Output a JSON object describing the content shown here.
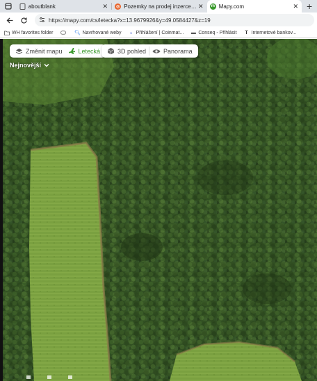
{
  "tabs": [
    {
      "title": "aboutblank",
      "active": false
    },
    {
      "title": "Pozemky na prodej inzerce - Real",
      "active": false
    },
    {
      "title": "Mapy.com",
      "active": true
    }
  ],
  "address": {
    "url": "https://mapy.com/cs/letecka?x=13.9679926&y=49.0584427&z=19"
  },
  "bookmarks": [
    {
      "label": "WH favorites folder",
      "icon": "folder-icon"
    },
    {
      "label": "",
      "icon": "bookmark-device-icon"
    },
    {
      "label": "Navrhované weby",
      "icon": "search-icon"
    },
    {
      "label": "Přihlášení | Coinmat...",
      "icon": "coin-icon"
    },
    {
      "label": "Conseq - Přihlásit",
      "icon": "conseq-icon"
    },
    {
      "label": "Internetové bankov...",
      "icon": "bank-icon"
    }
  ],
  "map_controls": {
    "change_map": "Změnit mapu",
    "aerial": "Letecká",
    "view_3d": "3D pohled",
    "panorama": "Panorama",
    "date_select": "Nejnovější"
  },
  "colors": {
    "accent": "#3a9a2c",
    "forest": "#2c4a1e",
    "meadow": "#7fa23f"
  }
}
